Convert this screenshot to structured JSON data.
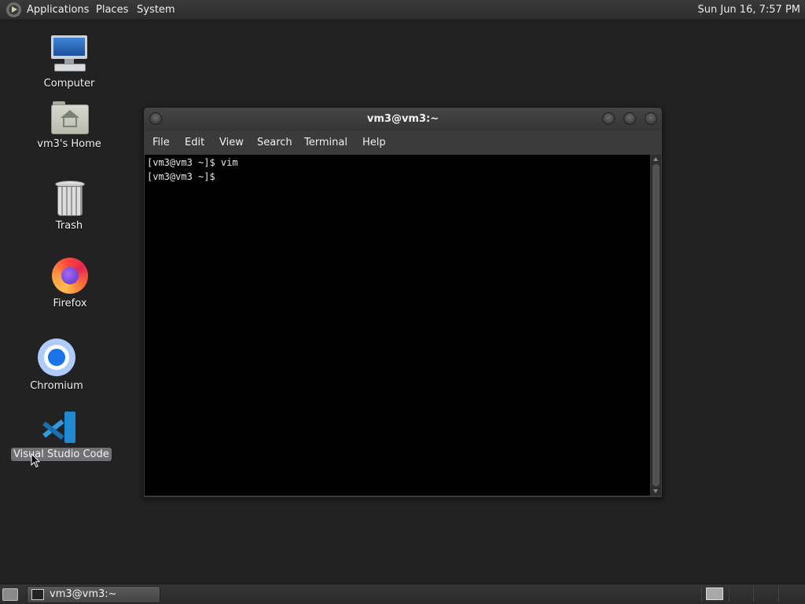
{
  "top_panel": {
    "menus": [
      "Applications",
      "Places",
      "System"
    ],
    "clock": "Sun Jun 16,  7:57 PM"
  },
  "desktop": {
    "icons": [
      {
        "label": "Computer",
        "icon": "computer-icon"
      },
      {
        "label": "vm3's Home",
        "icon": "home-folder-icon"
      },
      {
        "label": "Trash",
        "icon": "trash-icon"
      },
      {
        "label": "Firefox",
        "icon": "firefox-icon"
      },
      {
        "label": "Chromium",
        "icon": "chromium-icon"
      },
      {
        "label": "Visual Studio Code",
        "icon": "vscode-icon",
        "selected": true
      }
    ]
  },
  "terminal": {
    "title": "vm3@vm3:~",
    "menu": [
      "File",
      "Edit",
      "View",
      "Search",
      "Terminal",
      "Help"
    ],
    "lines": [
      "[vm3@vm3 ~]$ vim",
      "[vm3@vm3 ~]$ "
    ]
  },
  "bottom_panel": {
    "tasks": [
      {
        "label": "vm3@vm3:~",
        "icon": "terminal-icon"
      }
    ]
  }
}
